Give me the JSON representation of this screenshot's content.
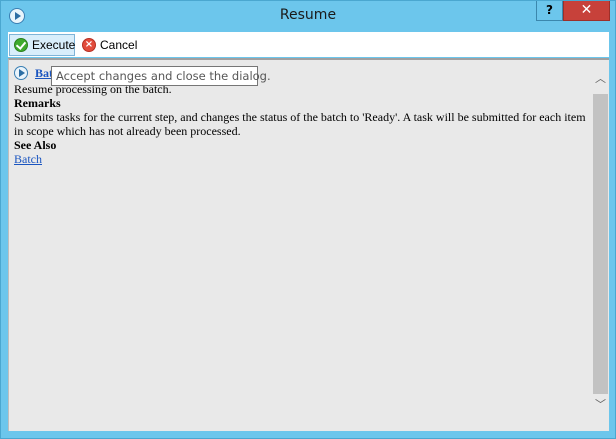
{
  "window": {
    "title": "Resume",
    "help_label": "?",
    "close_label": "✕"
  },
  "toolbar": {
    "execute_label": "Execute",
    "cancel_label": "Cancel",
    "execute_tooltip": "Accept changes and close the dialog."
  },
  "doc": {
    "title": "Batch",
    "summary": "Resume processing on the batch.",
    "remarks_heading": "Remarks",
    "remarks_text": "Submits tasks for the current step, and changes the status of the batch to 'Ready'. A task will be submitted for each item in scope which has not already been processed.",
    "see_also_heading": "See Also",
    "see_also_link": "Batch"
  },
  "scrollbar": {
    "up_glyph": "︿",
    "down_glyph": "﹀"
  }
}
